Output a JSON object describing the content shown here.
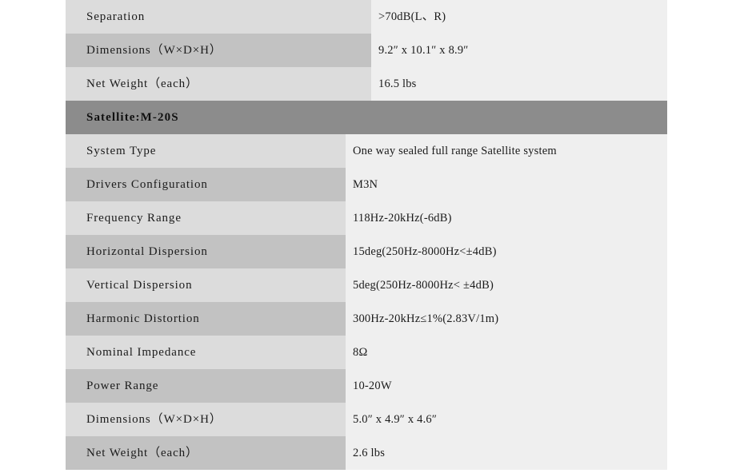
{
  "document": {
    "type": "specification-table",
    "colors": {
      "page_background": "#ffffff",
      "row_light": "#dcdcdc",
      "row_dark": "#c2c2c2",
      "value_column": "#efefef",
      "section_header": "#8c8c8c",
      "text": "#1b1b1b"
    }
  },
  "sections": [
    {
      "id": "subwoofer-continued",
      "heading": null,
      "rows": [
        {
          "label": "Separation",
          "value": ">70dB(L、R)"
        },
        {
          "label": "Dimensions（W×D×H）",
          "value": "9.2″ x 10.1″ x 8.9″"
        },
        {
          "label": "Net Weight（each）",
          "value": "16.5 lbs"
        }
      ]
    },
    {
      "id": "satellite-m20s",
      "heading": "Satellite:M-20S",
      "rows": [
        {
          "label": "System Type",
          "value": "One way sealed full range Satellite system"
        },
        {
          "label": "Drivers Configuration",
          "value": "M3N"
        },
        {
          "label": "Frequency Range",
          "value": "118Hz-20kHz(-6dB)"
        },
        {
          "label": "Horizontal Dispersion",
          "value": "15deg(250Hz-8000Hz<±4dB)"
        },
        {
          "label": "Vertical Dispersion",
          "value": "5deg(250Hz-8000Hz< ±4dB)"
        },
        {
          "label": "Harmonic Distortion",
          "value": "300Hz-20kHz≤1%(2.83V/1m)"
        },
        {
          "label": "Nominal Impedance",
          "value": "8Ω"
        },
        {
          "label": "Power Range",
          "value": "10-20W"
        },
        {
          "label": "Dimensions（W×D×H）",
          "value": "5.0″ x 4.9″ x 4.6″"
        },
        {
          "label": "Net Weight（each）",
          "value": "2.6 lbs"
        }
      ]
    }
  ]
}
